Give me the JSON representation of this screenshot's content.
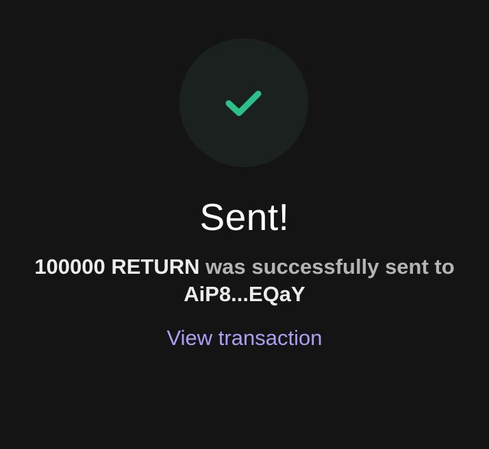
{
  "status": {
    "icon": "checkmark-icon",
    "accent_color": "#2ec08b",
    "circle_color": "#1b211f",
    "title": "Sent!"
  },
  "message": {
    "amount": "100000 RETURN",
    "text": " was successfully sent to",
    "recipient": "AiP8...EQaY"
  },
  "actions": {
    "view_transaction_label": "View transaction",
    "link_color": "#ab9ff2"
  }
}
